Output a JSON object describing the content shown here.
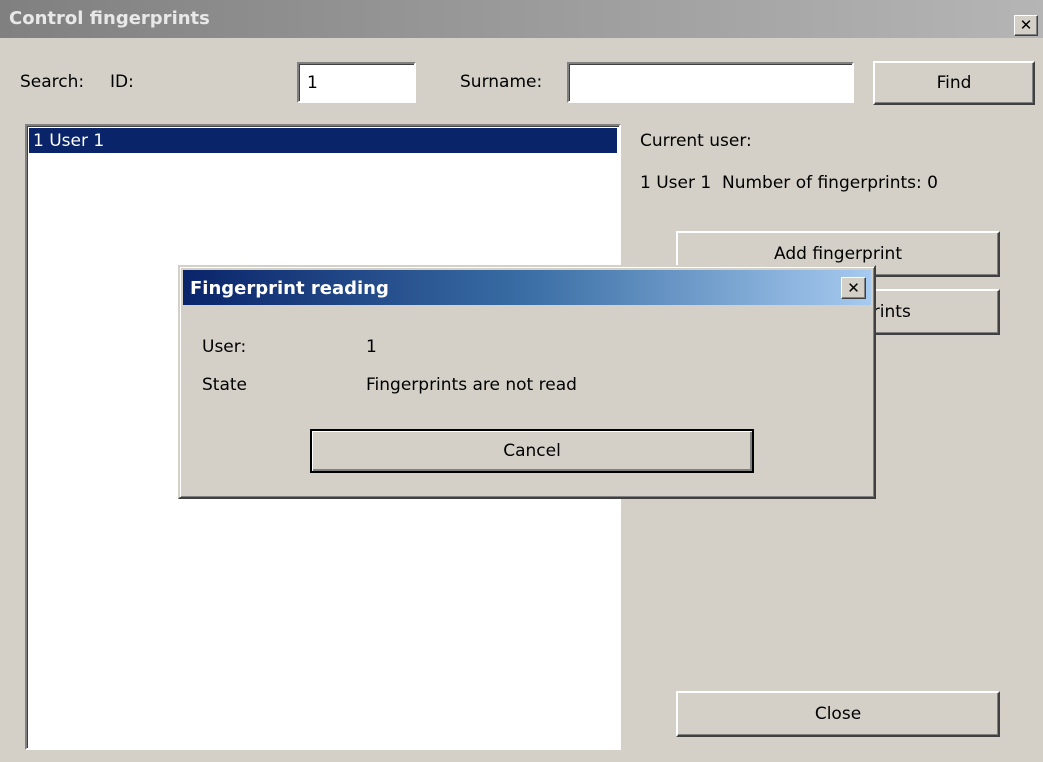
{
  "window": {
    "title": "Control fingerprints",
    "close_glyph": "✕"
  },
  "search": {
    "label": "Search:",
    "id_label": "ID:",
    "id_value": "1",
    "surname_label": "Surname:",
    "surname_value": "",
    "find_label": "Find"
  },
  "user_list": {
    "items": [
      {
        "label": "1 User 1",
        "selected": true
      }
    ]
  },
  "current_user": {
    "heading": "Current user:",
    "info": "1 User 1  Number of fingerprints: 0"
  },
  "actions": {
    "add_label": "Add fingerprint",
    "delete_label_visible": "prints",
    "close_label": "Close"
  },
  "dialog": {
    "title": "Fingerprint reading",
    "close_glyph": "✕",
    "user_label": "User:",
    "user_value": "1",
    "state_label": "State",
    "state_value": "Fingerprints are not read",
    "cancel_label": "Cancel"
  },
  "colors": {
    "selection": "#0a246a",
    "window_bg": "#d4d0c8"
  }
}
